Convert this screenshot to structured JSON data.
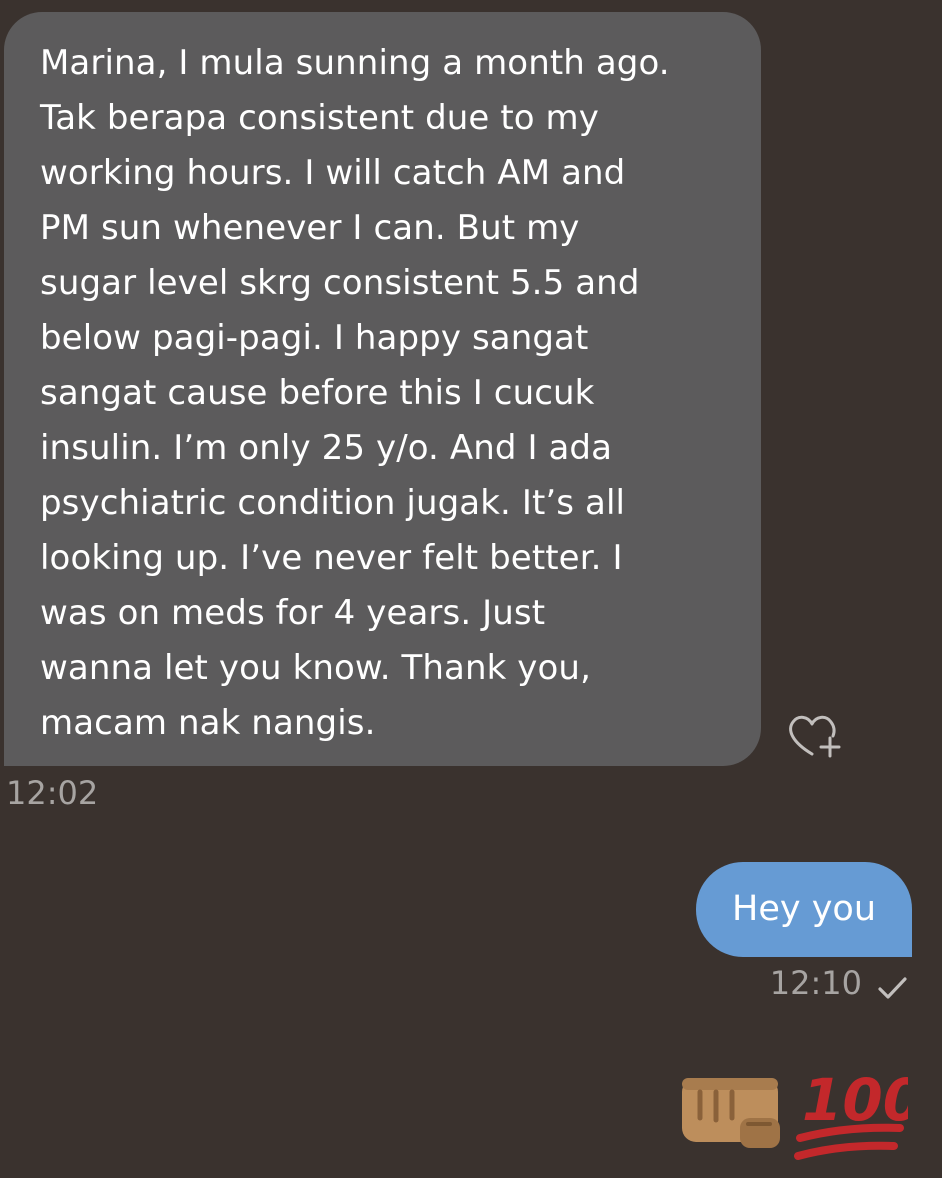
{
  "conversation": {
    "incoming": {
      "text": "Marina, I mula sunning a month ago.\nTak berapa consistent due to my\nworking hours. I will catch AM and\nPM sun whenever I can. But my\nsugar level skrg consistent 5.5 and\nbelow pagi-pagi. I happy sangat\nsangat cause before this I cucuk\ninsulin. I’m only 25 y/o. And I ada\npsychiatric condition jugak. It’s all\nlooking up. I’ve never felt better. I\nwas on meds for 4 years. Just\nwanna let you know. Thank you,\nmacam nak nangis.",
      "time": "12:02",
      "reaction_icon": "heart-plus-icon"
    },
    "outgoing": {
      "text": "Hey you",
      "time": "12:10",
      "status_icon": "check-icon"
    },
    "reactions": [
      "fist-bump-emoji",
      "hundred-points-emoji"
    ]
  },
  "colors": {
    "background": "#3a322e",
    "incoming_bubble": "#5c5b5c",
    "outgoing_bubble": "#669bd4",
    "timestamp": "#a7a4a2",
    "hundred_red": "#c3282b"
  }
}
